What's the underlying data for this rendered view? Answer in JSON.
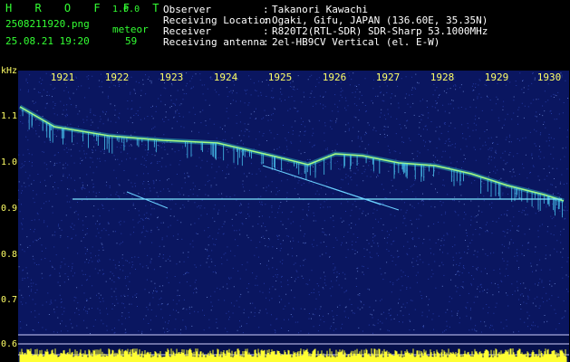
{
  "app": {
    "name": "H R O F F T",
    "version": "1.0.0"
  },
  "file": {
    "name": "2508211920.png",
    "datetime": "25.08.21 19:20"
  },
  "meteor": {
    "label": "meteor",
    "count": "59"
  },
  "info": [
    {
      "key": "Observer",
      "value": "Takanori Kawachi"
    },
    {
      "key": "Receiving Location",
      "value": "Ogaki, Gifu, JAPAN (136.60E, 35.35N)"
    },
    {
      "key": "Receiver",
      "value": "R820T2(RTL-SDR) SDR-Sharp 53.1000MHz"
    },
    {
      "key": "Receiving antenna",
      "value": "2el-HB9CV Vertical (el. E-W)"
    }
  ],
  "axis": {
    "unit": "kHz",
    "hours": [
      "1921",
      "1922",
      "1923",
      "1924",
      "1925",
      "1926",
      "1927",
      "1928",
      "1929",
      "1930"
    ],
    "freqs": [
      "1.1",
      "1.0",
      "0.9",
      "0.8",
      "0.7",
      "0.6"
    ]
  },
  "colors": {
    "text_green": "#33ff33",
    "axis_yellow": "#ffff66",
    "background_blue": "#0a1660"
  }
}
